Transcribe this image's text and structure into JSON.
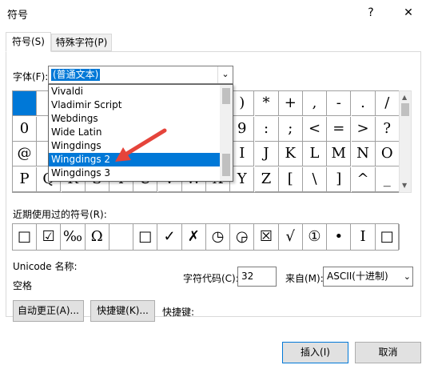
{
  "window": {
    "title": "符号",
    "help": "?",
    "close": "✕"
  },
  "tabs": [
    {
      "label": "符号(S)"
    },
    {
      "label": "特殊字符(P)"
    }
  ],
  "font": {
    "label": "字体(F):",
    "value": "(普通文本)"
  },
  "symbol_grid": [
    [
      "",
      "",
      "",
      "",
      "",
      "",
      "",
      "",
      "",
      ")",
      "*",
      "+",
      ",",
      "-",
      ".",
      "/"
    ],
    [
      "0",
      "",
      "",
      "",
      "",
      "",
      "",
      "",
      "",
      "9",
      ":",
      ";",
      "<",
      "=",
      ">",
      "?"
    ],
    [
      "@",
      "",
      "",
      "",
      "",
      "",
      "",
      "",
      "",
      "I",
      "J",
      "K",
      "L",
      "M",
      "N",
      "O"
    ],
    [
      "P",
      "Q",
      "R",
      "S",
      "T",
      "U",
      "V",
      "W",
      "X",
      "Y",
      "Z",
      "[",
      "\\",
      "]",
      "^",
      "_"
    ]
  ],
  "font_dropdown": {
    "items": [
      "Vivaldi",
      "Vladimir Script",
      "Webdings",
      "Wide Latin",
      "Wingdings",
      "Wingdings 2",
      "Wingdings 3"
    ],
    "selected_index": 5
  },
  "recent": {
    "label": "近期使用过的符号(R):",
    "symbols": [
      "□",
      "☑",
      "‰",
      "Ω",
      "",
      "□",
      "✓",
      "✗",
      "◷",
      "◶",
      "☒",
      "√",
      "①",
      "•",
      "Ⅰ",
      "□"
    ]
  },
  "unicode": {
    "label": "Unicode 名称:",
    "name": "空格"
  },
  "char_code": {
    "label": "字符代码(C):",
    "value": "32"
  },
  "from": {
    "label": "来自(M):",
    "value": "ASCII(十进制)"
  },
  "buttons": {
    "autocorrect": "自动更正(A)...",
    "shortcut": "快捷键(K)...",
    "shortcut_label": "快捷键:",
    "insert": "插入(I)",
    "cancel": "取消"
  },
  "colors": {
    "accent": "#0078d7",
    "annotation_arrow": "#e5443b"
  }
}
